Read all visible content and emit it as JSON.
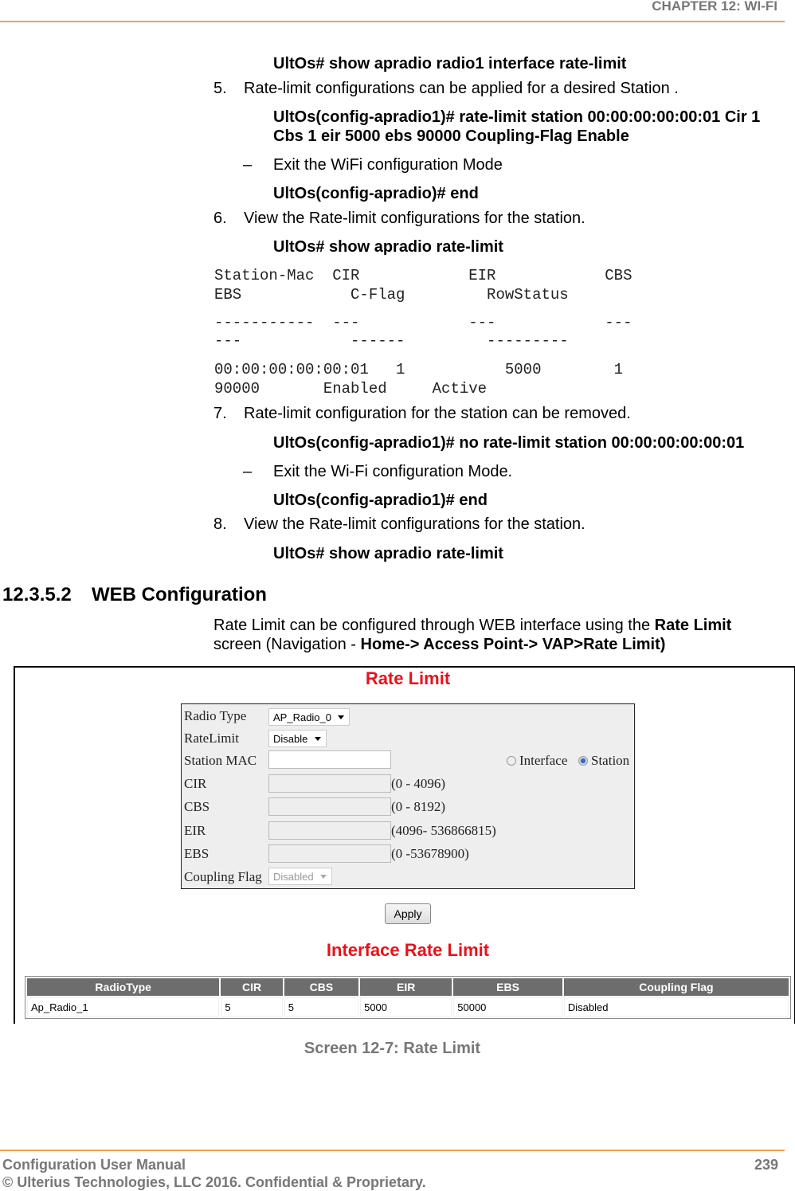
{
  "header": {
    "chapter": "CHAPTER 12: WI-FI"
  },
  "steps": {
    "cmd0": "UltOs# show apradio radio1 interface rate-limit",
    "s5_num": "5.",
    "s5": "Rate-limit configurations can be applied for a desired Station .",
    "cmd5a": "UltOs(config-apradio1)# rate-limit station 00:00:00:00:00:01 Cir 1",
    "cmd5b": "Cbs 1  eir 5000 ebs 90000 Coupling-Flag Enable",
    "dash1": "–",
    "exit1": "Exit the WiFi configuration Mode",
    "cmd5c": "UltOs(config-apradio)# end",
    "s6_num": "6.",
    "s6": "View the Rate-limit configurations for the station.",
    "cmd6": "UltOs# show apradio rate-limit",
    "out": [
      "Station-Mac  CIR            EIR            CBS",
      "EBS            C-Flag         RowStatus",
      "-----------  ---            ---            ---",
      "---            ------         ---------",
      "00:00:00:00:00:01   1           5000        1",
      "90000       Enabled     Active"
    ],
    "s7_num": "7.",
    "s7": "Rate-limit configuration for the station can be removed.",
    "cmd7": "UltOs(config-apradio1)# no rate-limit station 00:00:00:00:00:01",
    "dash2": "–",
    "exit2": "Exit the Wi-Fi configuration Mode.",
    "cmd7b": "UltOs(config-apradio1)# end",
    "s8_num": "8.",
    "s8": "View the Rate-limit configurations for the station.",
    "cmd8": "UltOs# show apradio rate-limit"
  },
  "section": {
    "number": "12.3.5.2",
    "title": "WEB Configuration",
    "p1a": "Rate Limit can be configured through WEB interface using the ",
    "p1b": "Rate Limit",
    "p2a": "screen (Navigation - ",
    "p2b": "Home-> Access Point-> VAP>Rate Limit)"
  },
  "screen": {
    "title": "Rate Limit",
    "form": {
      "radio_type_label": "Radio Type",
      "radio_type_value": "AP_Radio_0",
      "ratelimit_label": "RateLimit",
      "ratelimit_value": "Disable",
      "station_mac_label": "Station MAC",
      "station_mac_value": "",
      "interface_label": "Interface",
      "station_label": "Station",
      "cir_label": "CIR",
      "cir_range": "(0 - 4096)",
      "cbs_label": "CBS",
      "cbs_range": "(0 - 8192)",
      "eir_label": "EIR",
      "eir_range": "(4096- 536866815)",
      "ebs_label": "EBS",
      "ebs_range": "(0 -53678900)",
      "coupling_label": "Coupling Flag",
      "coupling_value": "Disabled",
      "apply": "Apply"
    },
    "table_title": "Interface Rate Limit",
    "columns": [
      "RadioType",
      "CIR",
      "CBS",
      "EIR",
      "EBS",
      "Coupling Flag"
    ],
    "rows": [
      [
        "Ap_Radio_1",
        "5",
        "5",
        "5000",
        "50000",
        "Disabled"
      ]
    ]
  },
  "caption": "Screen 12-7: Rate Limit",
  "footer": {
    "manual": "Configuration User Manual",
    "page": "239",
    "copyright": "© Ulterius Technologies, LLC 2016. Confidential & Proprietary."
  },
  "colors": {
    "accent_line": "#f0a050",
    "screen_title": "#e8121b",
    "table_header": "#6d6d6d"
  }
}
